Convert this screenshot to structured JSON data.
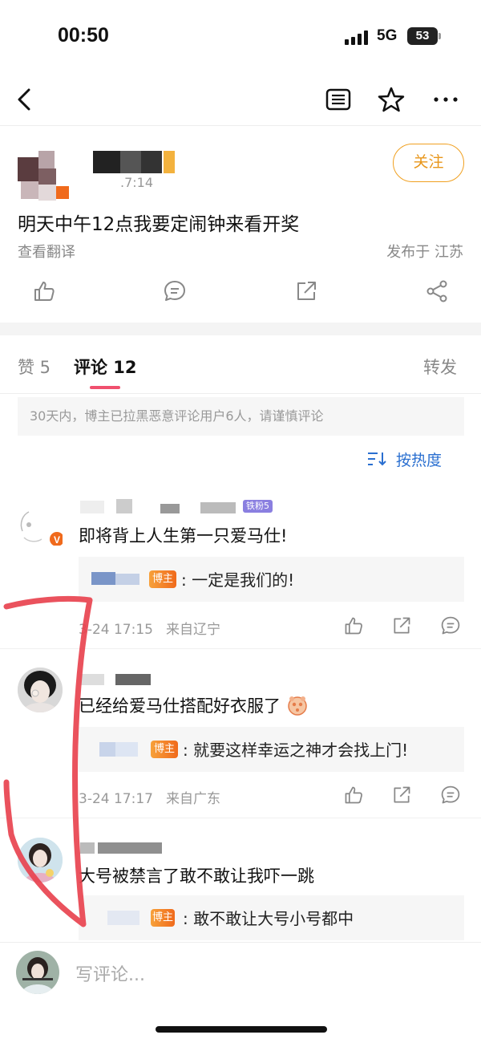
{
  "status_bar": {
    "time": "00:50",
    "network": "5G",
    "battery": "53"
  },
  "nav": {
    "back": "back-icon",
    "reader": "reader-icon",
    "favorite": "star-icon",
    "more": "more-icon"
  },
  "post": {
    "time": ".7:14",
    "follow_label": "关注",
    "text": "明天中午12点我要定闹钟来看开奖",
    "translate_label": "查看翻译",
    "location": "发布于 江苏",
    "actions": [
      "like-icon",
      "comment-icon",
      "share-icon",
      "forward-icon"
    ]
  },
  "tabs": {
    "likes": "赞 5",
    "comments": "评论 12",
    "reposts": "转发"
  },
  "notice": "30天内，博主已拉黑恶意评论用户6人，请谨慎评论",
  "sort_label": "按热度",
  "comments": [
    {
      "fan_badge": "铁粉5",
      "text": "即将背上人生第一只爱马仕!",
      "op_badge": "博主",
      "reply": ": 一定是我们的!",
      "time": "3-24 17:15",
      "from": "来自辽宁"
    },
    {
      "text": "已经给爱马仕搭配好衣服了",
      "op_badge": "博主",
      "reply": ": 就要这样幸运之神才会找上门!",
      "time": "3-24 17:17",
      "from": "来自广东"
    },
    {
      "text": "大号被禁言了敢不敢让我吓一跳",
      "op_badge": "博主",
      "reply": ": 敢不敢让大号小号都中"
    }
  ],
  "bottom": {
    "placeholder": "写评论..."
  },
  "colors": {
    "accent_orange": "#f0a020",
    "tab_underline": "#f0506e",
    "link_blue": "#2a6fd0",
    "annotation_red": "#e8434f"
  }
}
